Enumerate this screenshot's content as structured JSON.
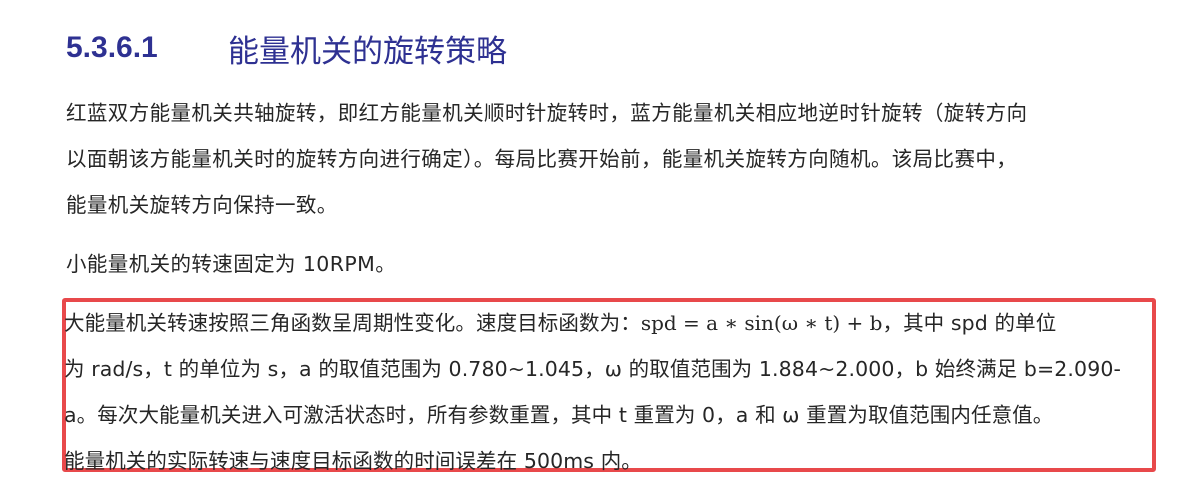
{
  "section": {
    "number": "5.3.6.1",
    "title": "能量机关的旋转策略"
  },
  "paragraph1": {
    "lines": [
      "红蓝双方能量机关共轴旋转，即红方能量机关顺时针旋转时，蓝方能量机关相应地逆时针旋转（旋转方向",
      "以面朝该方能量机关时的旋转方向进行确定）。每局比赛开始前，能量机关旋转方向随机。该局比赛中，",
      "能量机关旋转方向保持一致。"
    ]
  },
  "paragraph2": {
    "text": "小能量机关的转速固定为 10RPM。"
  },
  "highlight": {
    "border_color": "#e8494b",
    "line1_before": "大能量机关转速按照三角函数呈周期性变化。速度目标函数为：",
    "formula": "spd = a ∗ sin(ω ∗ t) + b",
    "line1_after": "，其中 spd 的单位",
    "line2": "为 rad/s，t 的单位为 s，a 的取值范围为 0.780~1.045，ω 的取值范围为 1.884~2.000，b 始终满足 b=2.090-",
    "line3": "a。每次大能量机关进入可激活状态时，所有参数重置，其中 t 重置为 0，a 和 ω 重置为取值范围内任意值。",
    "line4": "能量机关的实际转速与速度目标函数的时间误差在 500ms 内。"
  }
}
